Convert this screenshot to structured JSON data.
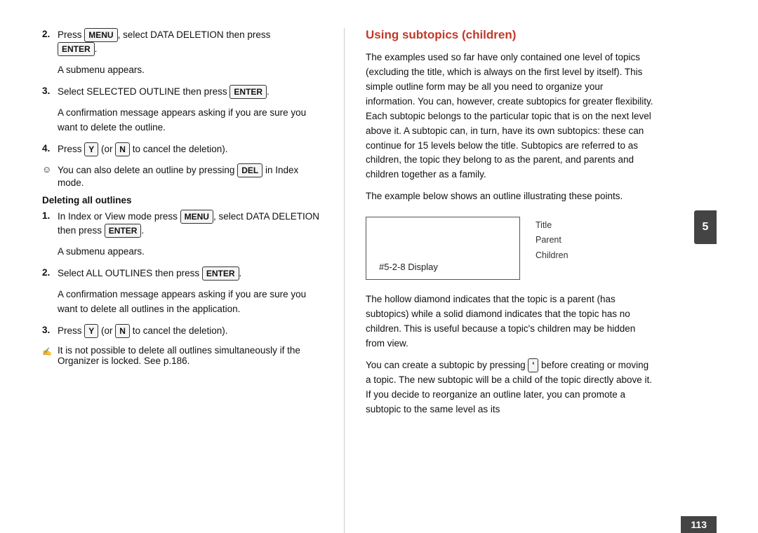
{
  "left": {
    "step2_press": "Press ",
    "step2_menu": "MENU",
    "step2_middle": ", select DATA DELETION then press",
    "step2_enter": "ENTER",
    "step2_period": ".",
    "submenu1": "A submenu appears.",
    "step3_text": "Select SELECTED OUTLINE then press ",
    "step3_enter": "ENTER",
    "step3_period": ".",
    "confirm1": "A confirmation message appears asking if you are sure you want to delete the outline.",
    "step4_press": "Press ",
    "step4_y": "Y",
    "step4_middle": " (or ",
    "step4_n": "N",
    "step4_end": " to cancel the deletion).",
    "note1_text": "You can also delete an outline by pressing ",
    "note1_del": "DEL",
    "note1_end": " in Index mode.",
    "bold_heading": "Deleting all outlines",
    "step1b_press": "In Index or View mode press ",
    "step1b_menu": "MENU",
    "step1b_middle": ", select DATA DELETION then press ",
    "step1b_enter": "ENTER",
    "step1b_period": ".",
    "submenu2": "A submenu appears.",
    "step2b_text": "Select ALL OUTLINES then press ",
    "step2b_enter": "ENTER",
    "step2b_period": ".",
    "confirm2": "A confirmation message appears asking if you are sure you want to delete all outlines in the application.",
    "step3b_press": "Press ",
    "step3b_y": "Y",
    "step3b_middle": " (or ",
    "step3b_n": "N",
    "step3b_end": " to cancel the deletion).",
    "note2_text": "It is not possible to delete all outlines simultaneously if the Organizer is locked. See p.186."
  },
  "right": {
    "section_title": "Using subtopics (children)",
    "para1": "The examples used so far have only contained one level of topics (excluding the title, which is always on the first level by itself). This simple outline form may be all you need to organize your information. You can, however, create subtopics for greater flexibility. Each subtopic belongs to the particular topic that is on the next level above it. A subtopic can, in turn, have its own subtopics: these can continue for 15 levels below the title. Subtopics are referred to as children, the topic they belong to as the parent, and parents and children together as a family.",
    "para2": "The example below shows an outline illustrating these points.",
    "diagram_display": "#5-2-8 Display",
    "legend_title": "Title",
    "legend_parent": "Parent",
    "legend_children": "Children",
    "para3": "The hollow diamond indicates that the topic is a parent (has subtopics) while a solid diamond indicates that the topic has no children. This is useful because a topic's children may be hidden from view.",
    "para4_start": "You can create a subtopic by pressing ",
    "para4_key": "'",
    "para4_end": " before creating or moving a topic. The new subtopic will be a child of the topic directly above it. If you decide to reorganize an outline later, you can promote a subtopic to the same level as its",
    "chapter_num": "5",
    "page_num": "113"
  }
}
